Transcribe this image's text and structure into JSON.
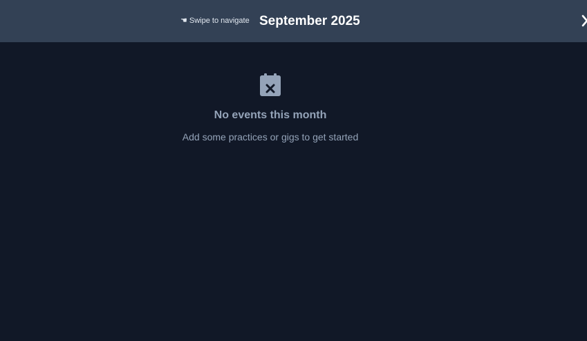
{
  "header": {
    "hint_icon": "pointing-hand-icon",
    "hint_glyph": "☚",
    "hint_text": "Swipe to navigate",
    "month_title": "September 2025",
    "close_icon": "close-icon"
  },
  "empty_state": {
    "icon": "calendar-x-icon",
    "title": "No events this month",
    "subtitle": "Add some practices or gigs to get started"
  },
  "colors": {
    "background": "#111827",
    "header_background": "#334155",
    "muted_text": "#94a3b8",
    "title_text": "#ffffff"
  }
}
